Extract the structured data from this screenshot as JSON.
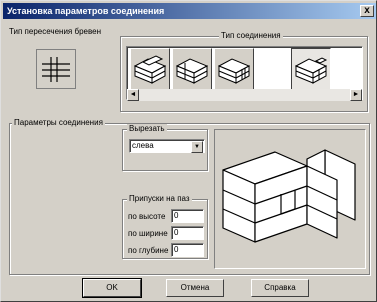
{
  "window": {
    "title": "Установка параметров соединения",
    "close_glyph": "x"
  },
  "intersection": {
    "label": "Тип пересечения бревен",
    "icon": "log-crossing-icon"
  },
  "connection_type": {
    "label": "Тип соединения",
    "options": [
      {
        "icon": "joint-type-1-icon",
        "selected": false
      },
      {
        "icon": "joint-type-2-icon",
        "selected": false
      },
      {
        "icon": "joint-type-3-icon",
        "selected": false
      },
      {
        "icon": "joint-type-4-icon",
        "selected": true
      }
    ],
    "scroll_left": "◄",
    "scroll_right": "►"
  },
  "params": {
    "label": "Параметры соединения",
    "cut": {
      "label": "Вырезать",
      "value": "слева",
      "arrow": "▼"
    },
    "allowances": {
      "label": "Припуски на паз",
      "height_label": "по высоте",
      "height_value": "0",
      "width_label": "по ширине",
      "width_value": "0",
      "depth_label": "по глубине",
      "depth_value": "0"
    },
    "preview_icon": "joint-preview-3d"
  },
  "buttons": {
    "ok": "OK",
    "cancel": "Отмена",
    "help": "Справка"
  }
}
